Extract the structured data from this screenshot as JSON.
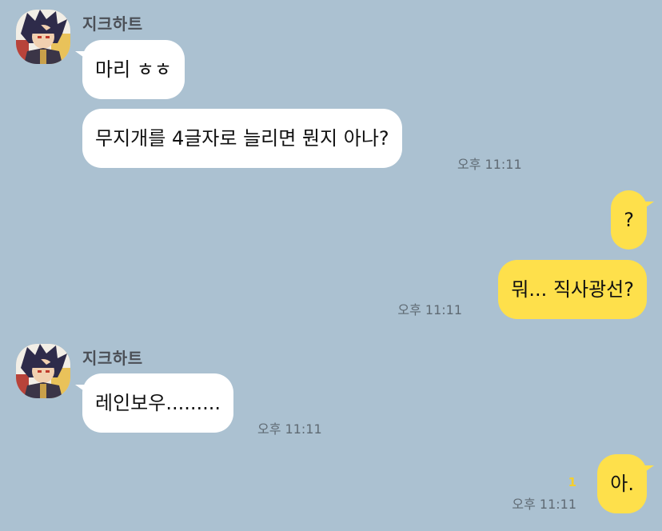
{
  "theme": {
    "background": "#abc1d1",
    "incoming_bubble": "#ffffff",
    "outgoing_bubble": "#fee04b",
    "unread_color": "#f5cf2a"
  },
  "messages": {
    "group1": {
      "sender": "지크하트",
      "avatar_icon": "character-avatar-icon",
      "bubble1": "마리 ㅎㅎ",
      "bubble2": "무지개를 4글자로 늘리면 뭔지 아나?",
      "time": "오후 11:11"
    },
    "group2": {
      "bubble1": "?",
      "bubble2": "뭐... 직사광선?",
      "time": "오후 11:11"
    },
    "group3": {
      "sender": "지크하트",
      "avatar_icon": "character-avatar-icon",
      "bubble1": "레인보우.........",
      "time": "오후 11:11"
    },
    "group4": {
      "bubble1": "아.",
      "unread": "1",
      "time": "오후 11:11"
    }
  }
}
